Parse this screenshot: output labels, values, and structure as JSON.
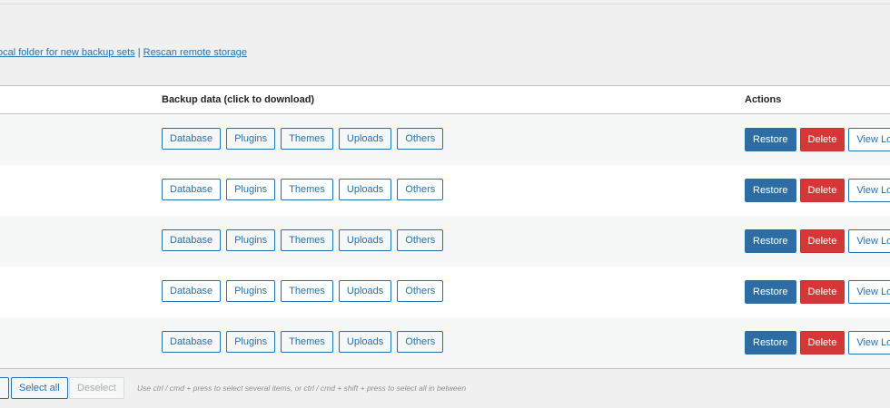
{
  "links": {
    "partial_link": "ocal folder for new backup sets",
    "separator": "|",
    "rescan_link": "Rescan remote storage"
  },
  "table": {
    "headers": {
      "backup_data": "Backup data (click to download)",
      "actions": "Actions"
    },
    "data_buttons": [
      "Database",
      "Plugins",
      "Themes",
      "Uploads",
      "Others"
    ],
    "action_buttons": {
      "restore": "Restore",
      "delete": "Delete",
      "view_log": "View Log"
    },
    "row_count": 5
  },
  "bottom": {
    "select_all": "Select all",
    "deselect": "Deselect",
    "hint": "Use ctrl / cmd + press to select several items, or ctrl / cmd + shift + press to select all in between"
  },
  "colors": {
    "background": "#f0f0f1",
    "link": "#2271b1",
    "restore": "#2e6da4",
    "delete": "#d63638",
    "alt_row": "#f6f7f7"
  }
}
